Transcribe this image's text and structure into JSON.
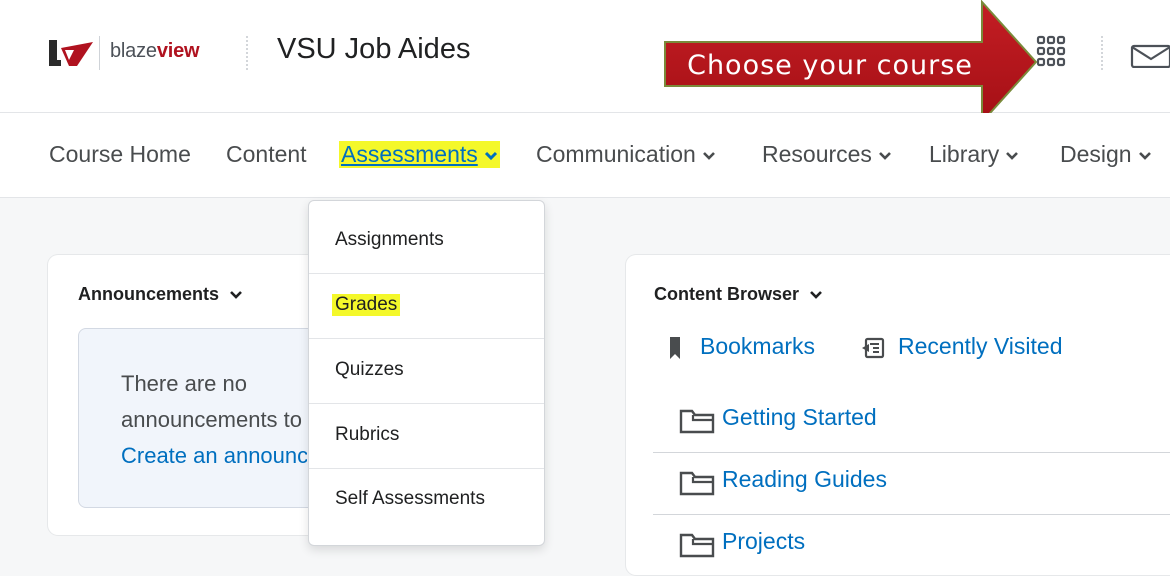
{
  "header": {
    "brand_light": "blaze",
    "brand_bold": "view",
    "course_title": "VSU Job Aides",
    "icons": [
      "grid-icon",
      "mail-icon"
    ]
  },
  "callout": {
    "text": "Choose your course",
    "color": "#b8161c"
  },
  "nav": {
    "items": [
      {
        "label": "Course Home"
      },
      {
        "label": "Content"
      },
      {
        "label": "Assessments"
      },
      {
        "label": "Communication"
      },
      {
        "label": "Resources"
      },
      {
        "label": "Library"
      },
      {
        "label": "Design"
      }
    ],
    "active_highlight": "#f4f82a",
    "link_color": "#006fbf"
  },
  "announcements": {
    "title": "Announcements",
    "empty_text": "There are no announcements to display.",
    "create_link": "Create an announcement"
  },
  "dropdown": {
    "items": [
      {
        "label": "Assignments"
      },
      {
        "label": "Grades"
      },
      {
        "label": "Quizzes"
      },
      {
        "label": "Rubrics"
      },
      {
        "label": "Self Assessments"
      }
    ]
  },
  "content_browser": {
    "title": "Content Browser",
    "bookmarks": "Bookmarks",
    "recently_visited": "Recently Visited",
    "folders": [
      {
        "name": "Getting Started"
      },
      {
        "name": "Reading Guides"
      },
      {
        "name": "Projects"
      }
    ]
  }
}
